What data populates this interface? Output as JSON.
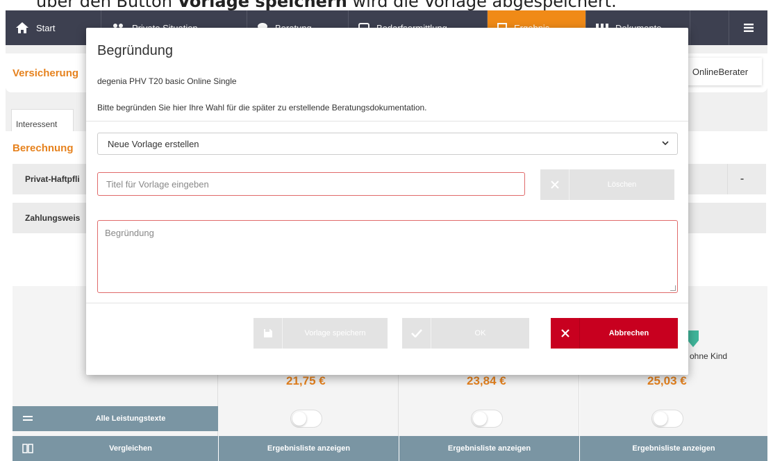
{
  "caption": {
    "pre": "über den Button ",
    "bold": "Vorlage speichern",
    "post": " wird die Vorlage abgespeichert."
  },
  "nav": {
    "items": [
      {
        "label": "Start",
        "icon": "home-icon"
      },
      {
        "label": "Private Situation",
        "icon": "people-icon"
      },
      {
        "label": "Beratung",
        "icon": "chat-icon"
      },
      {
        "label": "Bedarfsermittlung",
        "icon": "window-icon"
      },
      {
        "label": "Ergebnis",
        "icon": "clipboard-icon",
        "active": true
      },
      {
        "label": "Dokumente",
        "icon": "documents-icon"
      }
    ],
    "menu_icon": "hamburger-icon",
    "accent": "#f08a17",
    "background": "#3d4050"
  },
  "page": {
    "insurance_title": "Versicherung",
    "online_berater": "OnlineBerater",
    "tab_interessent": "Interessent",
    "berechnung": "Berechnung",
    "row_privat": "Privat-Haftpfli",
    "row_zahlung": "Zahlungsweis",
    "plus": "+",
    "minus": "-",
    "ohne_kind": "ohne Kind",
    "prices": [
      "21,75 €",
      "23,84 €",
      "25,03 €"
    ],
    "alle_leistungstexte": "Alle Leistungstexte",
    "vergleichen": "Vergleichen",
    "ergebnisliste": [
      "Ergebnisliste anzeigen",
      "Ergebnisliste anzeigen",
      "Ergebnisliste anzeigen"
    ]
  },
  "modal": {
    "title": "Begründung",
    "product": "degenia PHV T20 basic Online Single",
    "info": "Bitte begründen Sie hier Ihre Wahl für die später zu erstellende Beratungsdokumentation.",
    "template_select": {
      "selected": "Neue Vorlage erstellen"
    },
    "title_input": {
      "placeholder": "Titel für Vorlage eingeben",
      "value": ""
    },
    "delete_button": "Löschen",
    "reason_textarea": {
      "placeholder": "Begründung",
      "value": ""
    },
    "save_template_button": "Vorlage speichern",
    "ok_button": "OK",
    "cancel_button": "Abbrechen",
    "cancel_color": "#c8001f"
  }
}
